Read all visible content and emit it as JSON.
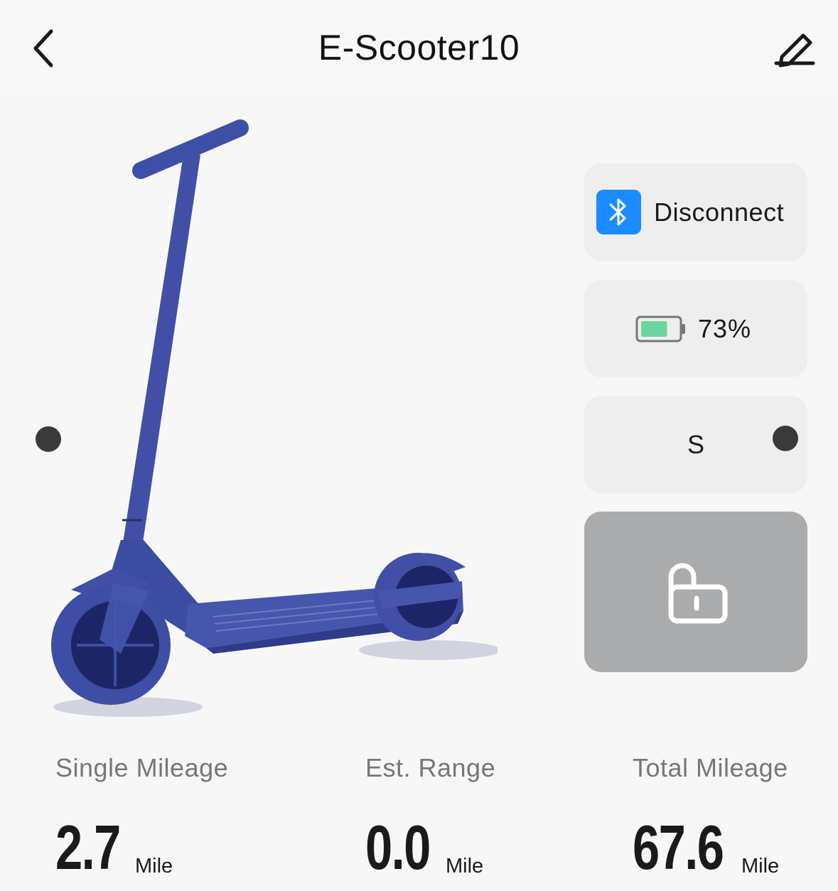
{
  "header": {
    "title": "E-Scooter10"
  },
  "status_cards": {
    "bluetooth": {
      "label": "Disconnect",
      "icon": "bluetooth-icon",
      "color": "#1b8cff"
    },
    "battery": {
      "label": "73%",
      "level": 0.73,
      "icon": "battery-icon",
      "fill_color": "#6dd6a0"
    },
    "mode": {
      "label": "S"
    },
    "lock": {
      "icon": "unlocked-padlock-icon"
    }
  },
  "stats": [
    {
      "label": "Single Mileage",
      "value": "2.7",
      "unit": "Mile"
    },
    {
      "label": "Est. Range",
      "value": "0.0",
      "unit": "Mile"
    },
    {
      "label": "Total Mileage",
      "value": "67.6",
      "unit": "Mile"
    }
  ],
  "colors": {
    "scooter": "#4150a6",
    "scooter_dark": "#1f2a6e",
    "background": "#f7f7f7"
  }
}
